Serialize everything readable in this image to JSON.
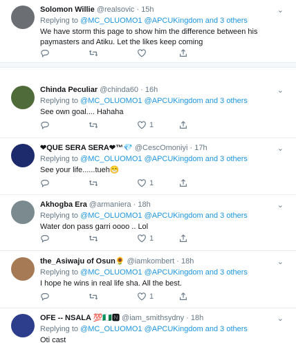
{
  "colors": {
    "link": "#1b95e0",
    "muted": "#657786",
    "text": "#14171a"
  },
  "tweets": [
    {
      "name": "Solomon Willie",
      "handle": "@realsovic",
      "time": "15h",
      "replying_prefix": "Replying to ",
      "mention1": "@MC_OLUOMO1",
      "mention2": "@APCUKingdom and 3 others",
      "text": "We have storm this page to show him the difference between his paymasters and Atiku. Let the likes keep coming",
      "likes": "",
      "avatar_color": "#6b6f73"
    },
    {
      "name": "Chinda Peculiar",
      "handle": "@chinda60",
      "time": "16h",
      "replying_prefix": "Replying to ",
      "mention1": "@MC_OLUOMO1",
      "mention2": "@APCUKingdom and 3 others",
      "text": "See own goal.... Hahaha",
      "likes": "1",
      "avatar_color": "#4f6b3a"
    },
    {
      "name": "❤QUE SERA SERA❤™💎",
      "handle": "@CescOmoniyi",
      "time": "17h",
      "replying_prefix": "Replying to ",
      "mention1": "@MC_OLUOMO1",
      "mention2": "@APCUKingdom and 3 others",
      "text": "See your life......tueh😁",
      "likes": "1",
      "avatar_color": "#1d2a6b"
    },
    {
      "name": "Akhogba Era",
      "handle": "@armaniera",
      "time": "18h",
      "replying_prefix": "Replying to ",
      "mention1": "@MC_OLUOMO1",
      "mention2": "@APCUKingdom and 3 others",
      "text": "Water don pass garri oooo .. Lol",
      "likes": "1",
      "avatar_color": "#7a8a8f"
    },
    {
      "name": "the_Asiwaju of Osun🌻",
      "handle": "@iamkombert",
      "time": "18h",
      "replying_prefix": "Replying to ",
      "mention1": "@MC_OLUOMO1",
      "mention2": "@APCUKingdom and 3 others",
      "text": "I hope he wins in real life sha. All the best.",
      "likes": "1",
      "avatar_color": "#a67a55"
    },
    {
      "name": "OFE -- NSALA 💯🇳🇬🅽",
      "handle": "@iam_smithsydny",
      "time": "18h",
      "replying_prefix": "Replying to ",
      "mention1": "@MC_OLUOMO1",
      "mention2": "@APCUKingdom and 3 others",
      "text": "Oti cast",
      "likes": "",
      "avatar_color": "#2c3e8c"
    }
  ]
}
